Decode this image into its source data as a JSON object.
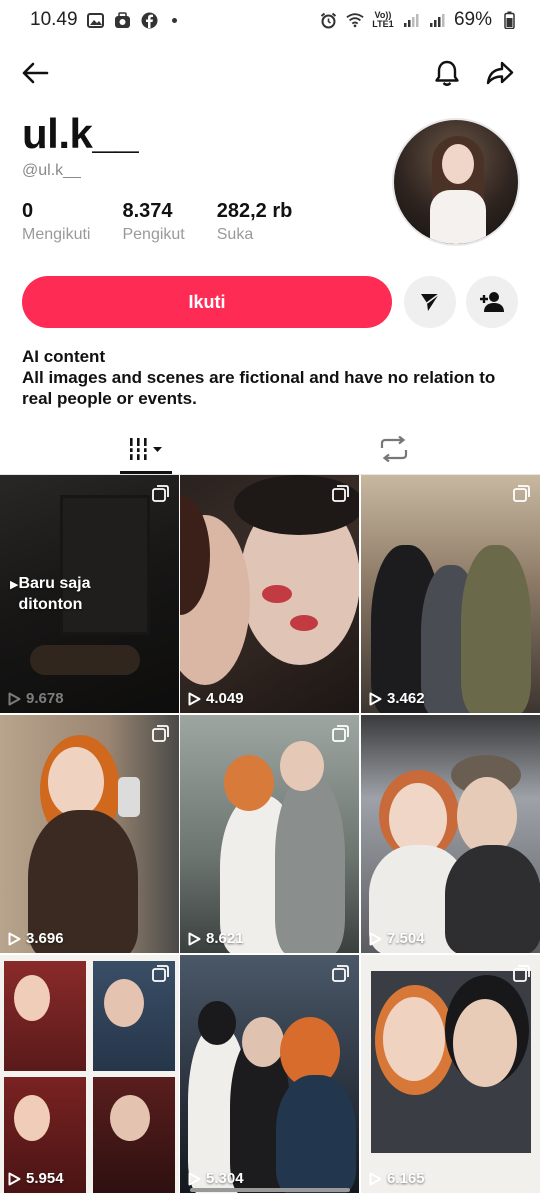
{
  "status_bar": {
    "time": "10.49",
    "network_label": "Vo)) LTE1",
    "battery": "69%"
  },
  "profile": {
    "display_name": "ul.k__",
    "handle": "@ul.k__",
    "stats": [
      {
        "value": "0",
        "label": "Mengikuti"
      },
      {
        "value": "8.374",
        "label": "Pengikut"
      },
      {
        "value": "282,2 rb",
        "label": "Suka"
      }
    ],
    "follow_label": "Ikuti",
    "bio_line1": "AI content",
    "bio_line2": "All images and scenes are fictional and have no relation to real people or events."
  },
  "tabs": [
    "videos-tab",
    "reposts-tab"
  ],
  "videos": [
    {
      "views": "9.678",
      "watched_label": "Baru saja ditonton"
    },
    {
      "views": "4.049"
    },
    {
      "views": "3.462"
    },
    {
      "views": "3.696"
    },
    {
      "views": "8.621"
    },
    {
      "views": "7.504"
    },
    {
      "views": "5.954"
    },
    {
      "views": "5.304"
    },
    {
      "views": "6.165"
    }
  ],
  "colors": {
    "accent": "#fe2c55",
    "muted_text": "#9a9a9a"
  }
}
